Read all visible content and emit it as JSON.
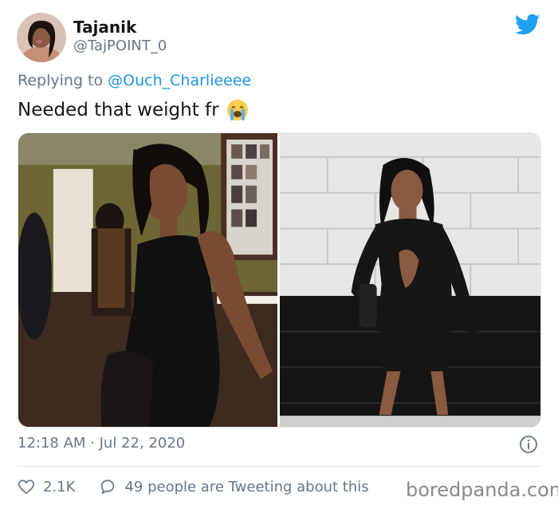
{
  "author": {
    "name": "Tajanik",
    "handle": "@TajPOINT_0",
    "avatar_icon": "user-avatar"
  },
  "brand": {
    "icon": "twitter-bird-icon",
    "color": "#1da1f2"
  },
  "reply": {
    "prefix": "Replying to",
    "mention": "@Ouch_Charlieeee"
  },
  "tweet": {
    "text": "Needed that weight fr",
    "emoji": "loudly-crying-face-emoji"
  },
  "media": {
    "count": 2,
    "images": [
      {
        "name": "photo-woman-black-velvet-dress-indoors"
      },
      {
        "name": "photo-woman-black-cutout-dress-brick-wall"
      }
    ]
  },
  "meta": {
    "timestamp": "12:18 AM · Jul 22, 2020"
  },
  "actions": {
    "likes": "2.1K",
    "conversation": "49 people are Tweeting about this"
  },
  "watermark": "boredpanda.com",
  "colors": {
    "text_primary": "#14171a",
    "text_secondary": "#657786",
    "link": "#1b95e0",
    "border": "#e1e8ed"
  }
}
